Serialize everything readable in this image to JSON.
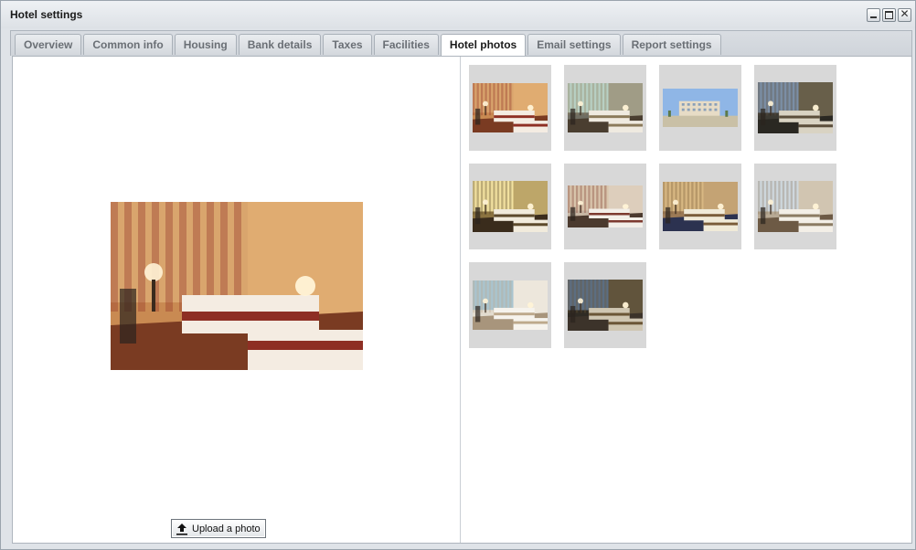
{
  "window": {
    "title": "Hotel settings",
    "controls": [
      "minimize",
      "maximize",
      "close"
    ]
  },
  "tabs": [
    {
      "label": "Overview",
      "active": false
    },
    {
      "label": "Common info",
      "active": false
    },
    {
      "label": "Housing",
      "active": false
    },
    {
      "label": "Bank details",
      "active": false
    },
    {
      "label": "Taxes",
      "active": false
    },
    {
      "label": "Facilities",
      "active": false
    },
    {
      "label": "Hotel photos",
      "active": true
    },
    {
      "label": "Email settings",
      "active": false
    },
    {
      "label": "Report settings",
      "active": false
    }
  ],
  "upload": {
    "label": "Upload a photo",
    "icon": "upload-icon"
  },
  "selected_photo": {
    "scene": "warm-room"
  },
  "photos": [
    {
      "scene": "warm-room"
    },
    {
      "scene": "bedroom-window"
    },
    {
      "scene": "building-exterior"
    },
    {
      "scene": "suite-dark"
    },
    {
      "scene": "room-yellow"
    },
    {
      "scene": "twin-room"
    },
    {
      "scene": "round-bed"
    },
    {
      "scene": "bright-room"
    },
    {
      "scene": "balcony-room"
    },
    {
      "scene": "dark-suite"
    }
  ]
}
